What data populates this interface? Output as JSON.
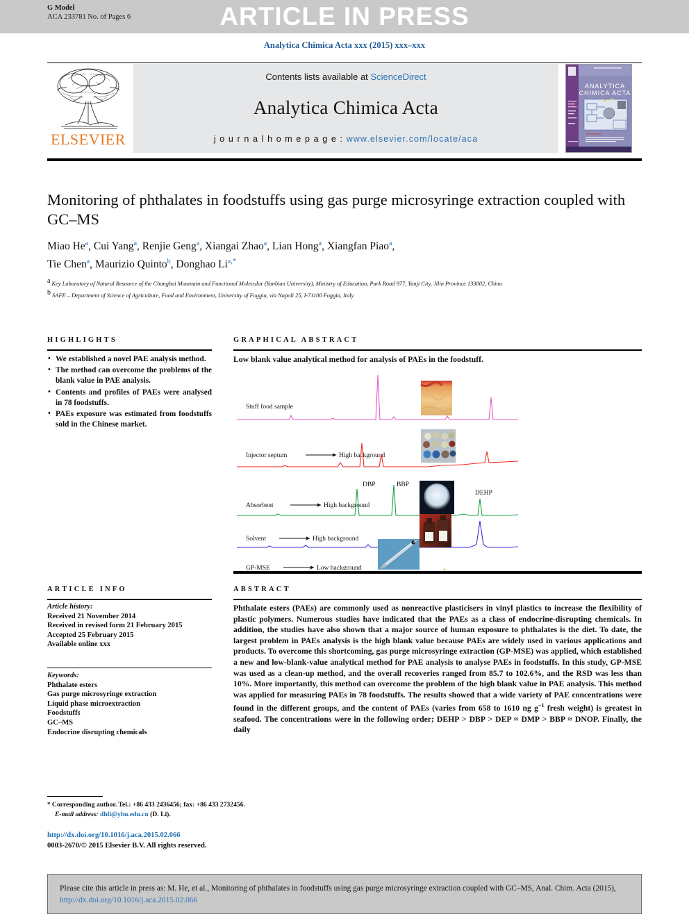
{
  "banner": {
    "g_model_label": "G Model",
    "g_model_code": "ACA 233781 No. of Pages 6",
    "article_in_press": "ARTICLE IN PRESS"
  },
  "journal_ref": "Analytica Chimica Acta xxx (2015) xxx–xxx",
  "masthead": {
    "contents_prefix": "Contents lists available at ",
    "contents_link": "ScienceDirect",
    "journal_title": "Analytica Chimica Acta",
    "homepage_prefix": "j o u r n a l   h o m e p a g e :  ",
    "homepage_url": "www.elsevier.com/locate/aca",
    "publisher": "ELSEVIER",
    "cover_title_line1": "ANALYTICA",
    "cover_title_line2": "CHIMICA ACTA"
  },
  "article": {
    "title": "Monitoring of phthalates in foodstuffs using gas purge microsyringe extraction coupled with GC–MS",
    "authors_line1_parts": [
      {
        "name": "Miao He",
        "sup": "a"
      },
      {
        "name": "Cui Yang",
        "sup": "a"
      },
      {
        "name": "Renjie Geng",
        "sup": "a"
      },
      {
        "name": "Xiangai Zhao",
        "sup": "a"
      },
      {
        "name": "Lian Hong",
        "sup": "a"
      },
      {
        "name": "Xiangfan Piao",
        "sup": "a"
      }
    ],
    "authors_line2_parts": [
      {
        "name": "Tie Chen",
        "sup": "a"
      },
      {
        "name": "Maurizio Quinto",
        "sup": "b"
      },
      {
        "name": "Donghao Li",
        "sup": "a,*"
      }
    ],
    "affiliation_a": "Key Laboratory of Natural Resource of the Changbai Mountain and Functional Molecular (Yanbian University), Ministry of Education, Park Road 977, Yanji City, Jilin Province 133002, China",
    "affiliation_b": "SAFE – Department of Science of Agriculture, Food and Environment, University of Foggia, via Napoli 25, I-71100 Foggia, Italy"
  },
  "highlights": {
    "heading": "HIGHLIGHTS",
    "items": [
      "We established a novel PAE analysis method.",
      "The method can overcome the problems of the blank value in PAE analysis.",
      "Contents and profiles of PAEs were analysed in 78 foodstuffs.",
      "PAEs exposure was estimated from foodstuffs sold in the Chinese market."
    ]
  },
  "graphical_abstract": {
    "heading": "GRAPHICAL ABSTRACT",
    "caption": "Low blank value analytical method for analysis of PAEs in the foodstuff.",
    "traces": [
      {
        "label": "Stuff food sample",
        "arrow": "",
        "note": "",
        "color": "#e857c8"
      },
      {
        "label": "Injector septum",
        "arrow": "⟶",
        "note": "High background",
        "color": "#ee2a22"
      },
      {
        "label": "Absorbent",
        "arrow": "⟶",
        "note": "High background",
        "color": "#1e9e3e"
      },
      {
        "label": "Solvent",
        "arrow": "⟶",
        "note": "High background",
        "color": "#3730d6"
      },
      {
        "label": "GP-MSE",
        "arrow": "⟶",
        "note": "Low background",
        "color": "#f08a2a"
      }
    ],
    "peak_labels": [
      "DBP",
      "BBP",
      "DEHP"
    ],
    "inset_images": [
      "fried-food-photo",
      "septum-discs-photo",
      "absorbent-powder-photo",
      "solvent-bottles-photo",
      "microsyringe-photo"
    ]
  },
  "article_info": {
    "heading": "ARTICLE INFO",
    "history_label": "Article history:",
    "history": [
      "Received 21 November 2014",
      "Received in revised form 21 February 2015",
      "Accepted 25 February 2015",
      "Available online xxx"
    ],
    "keywords_label": "Keywords:",
    "keywords": [
      "Phthalate esters",
      "Gas purge microsyringe extraction",
      "Liquid phase microextraction",
      "Foodstuffs",
      "GC–MS",
      "Endocrine disrupting chemicals"
    ]
  },
  "abstract": {
    "heading": "ABSTRACT",
    "text": "Phthalate esters (PAEs) are commonly used as nonreactive plasticisers in vinyl plastics to increase the flexibility of plastic polymers. Numerous studies have indicated that the PAEs as a class of endocrine-disrupting chemicals. In addition, the studies have also shown that a major source of human exposure to phthalates is the diet. To date, the largest problem in PAEs analysis is the high blank value because PAEs are widely used in various applications and products. To overcome this shortcoming, gas purge microsyringe extraction (GP-MSE) was applied, which established a new and low-blank-value analytical method for PAE analysis to analyse PAEs in foodstuffs. In this study, GP-MSE was used as a clean-up method, and the overall recoveries ranged from 85.7 to 102.6%, and the RSD was less than 10%. More importantly, this method can overcome the problem of the high blank value in PAE analysis. This method was applied for measuring PAEs in 78 foodstuffs. The results showed that a wide variety of PAE concentrations were found in the different groups, and the content of PAEs (varies from 658 to 1610 ng g",
    "text_sup": "−1",
    "text_tail": " fresh weight) is greatest in seafood. The concentrations were in the following order; DEHP > DBP > DEP ≈ DMP > BBP ≈ DNOP. Finally, the daily"
  },
  "footer": {
    "corresponding_star": "*",
    "corresponding_text": "Corresponding author. Tel.: +86 433 2436456; fax: +86 433 2732456.",
    "email_label": "E-mail address:",
    "email": "dhli@ybu.edu.cn",
    "email_owner": "(D. Li).",
    "doi_url": "http://dx.doi.org/10.1016/j.aca.2015.02.066",
    "copyright": "0003-2670/© 2015 Elsevier B.V. All rights reserved."
  },
  "cite_box": {
    "text": "Please cite this article in press as: M. He, et al., Monitoring of phthalates in foodstuffs using gas purge microsyringe extraction coupled with GC–MS, Anal. Chim. Acta (2015), ",
    "doi": "http://dx.doi.org/10.1016/j.aca.2015.02.066"
  },
  "colors": {
    "banner_grey": "#c9c9c9",
    "link_blue": "#2d72b5",
    "elsevier_orange": "#E87722",
    "masthead_grey": "#e6e7e8"
  }
}
